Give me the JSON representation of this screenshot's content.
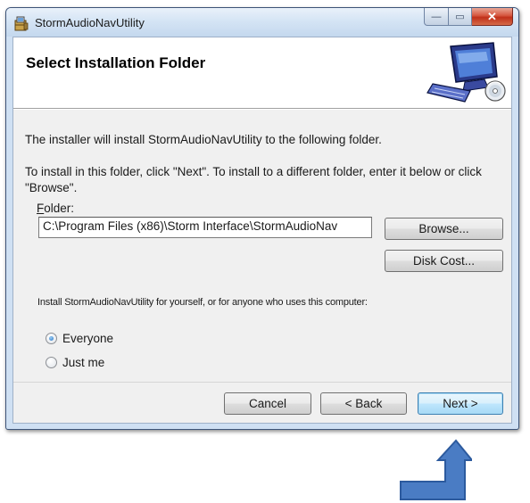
{
  "window": {
    "title": "StormAudioNavUtility",
    "caption": {
      "minimize": "—",
      "maximize": "▭",
      "close": "✕"
    }
  },
  "banner": {
    "title": "Select Installation Folder",
    "art_icon": "computer-install-icon"
  },
  "content": {
    "intro": "The installer will install StormAudioNavUtility to the following folder.",
    "instructions": "To install in this folder, click \"Next\". To install to a different folder, enter it below or click \"Browse\".",
    "folder_label_accel": "F",
    "folder_label_rest": "older:",
    "folder_value": "C:\\Program Files (x86)\\Storm Interface\\StormAudioNav",
    "browse_label": "Browse...",
    "disk_cost_label": "Disk Cost...",
    "install_for_label": "Install StormAudioNavUtility for yourself, or for anyone who uses this computer:",
    "radio_options": [
      {
        "label": "Everyone",
        "checked": true
      },
      {
        "label": "Just me",
        "checked": false
      }
    ]
  },
  "footer": {
    "cancel_label": "Cancel",
    "back_label": "< Back",
    "next_label": "Next >"
  },
  "colors": {
    "accent_arrow": "#4a7cc4",
    "next_button_border": "#3c7fb1",
    "close_button": "#c0301a"
  }
}
